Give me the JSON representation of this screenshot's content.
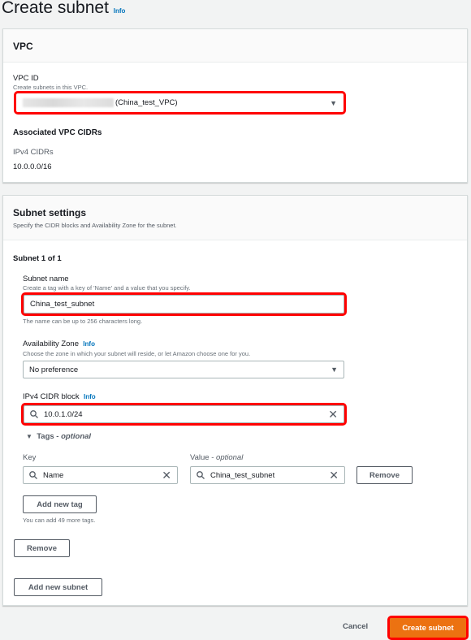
{
  "header": {
    "title": "Create subnet",
    "info": "Info"
  },
  "vpc": {
    "heading": "VPC",
    "vpc_id_label": "VPC ID",
    "vpc_id_desc": "Create subnets in this VPC.",
    "vpc_id_value": "(China_test_VPC)",
    "cidrs_heading": "Associated VPC CIDRs",
    "ipv4_label": "IPv4 CIDRs",
    "ipv4_value": "10.0.0.0/16"
  },
  "subnet_settings": {
    "heading": "Subnet settings",
    "desc": "Specify the CIDR blocks and Availability Zone for the subnet.",
    "subnet_count": "Subnet 1 of 1",
    "name_label": "Subnet name",
    "name_desc": "Create a tag with a key of 'Name' and a value that you specify.",
    "name_value": "China_test_subnet",
    "name_hint": "The name can be up to 256 characters long.",
    "az_label": "Availability Zone",
    "az_info": "Info",
    "az_desc": "Choose the zone in which your subnet will reside, or let Amazon choose one for you.",
    "az_value": "No preference",
    "cidr_label": "IPv4 CIDR block",
    "cidr_info": "Info",
    "cidr_value": "10.0.1.0/24",
    "tags_label": "Tags - ",
    "tags_optional": "optional",
    "key_label": "Key",
    "value_label": "Value - ",
    "value_optional": "optional",
    "tag_key": "Name",
    "tag_value": "China_test_subnet",
    "remove_tag": "Remove",
    "add_tag": "Add new tag",
    "tags_hint": "You can add 49 more tags.",
    "remove_subnet": "Remove",
    "add_subnet": "Add new subnet"
  },
  "footer": {
    "cancel": "Cancel",
    "create": "Create subnet"
  },
  "colors": {
    "accent": "#ec7211",
    "highlight": "#ff0000",
    "link": "#0073bb"
  }
}
